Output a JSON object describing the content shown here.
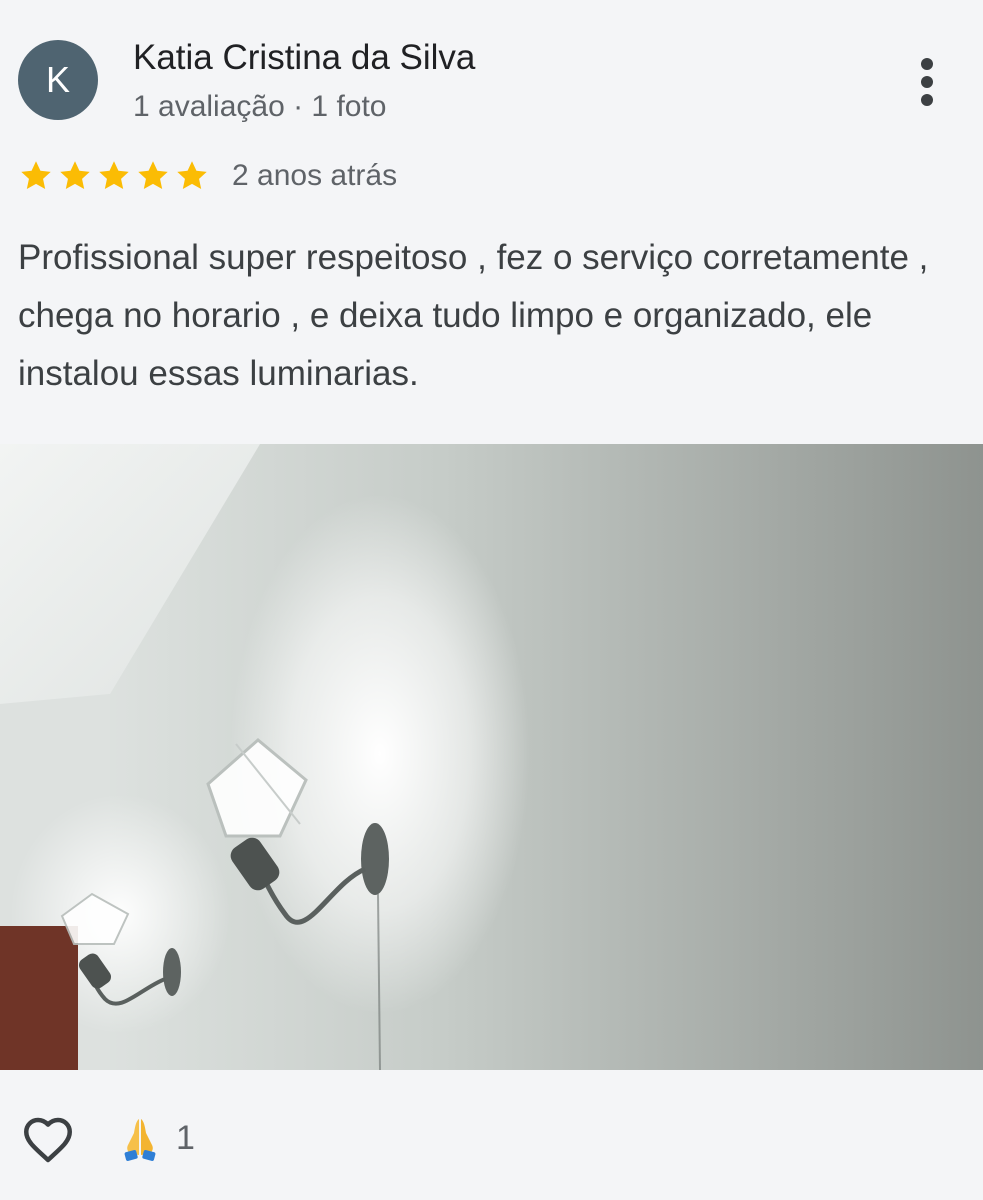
{
  "review": {
    "author": {
      "initial": "K",
      "name": "Katia Cristina da Silva",
      "meta": "1 avaliação · 1 foto",
      "avatar_color": "#4f6471"
    },
    "rating": 5,
    "rating_max": 5,
    "time_ago": "2 anos atrás",
    "text": "Profissional super respeitoso , fez o serviço corretamente , chega no horario , e deixa tudo limpo e organizado, ele instalou essas luminarias.",
    "photo_count_shown": 1,
    "more_icon": "more-vert-icon"
  },
  "actions": {
    "like_icon": "heart-outline-icon",
    "reaction_icon": "folded-hands-icon",
    "reaction_count": "1"
  },
  "colors": {
    "star": "#fbbc04",
    "text_primary": "#202124",
    "text_secondary": "#5f6368",
    "background": "#f4f5f7"
  }
}
